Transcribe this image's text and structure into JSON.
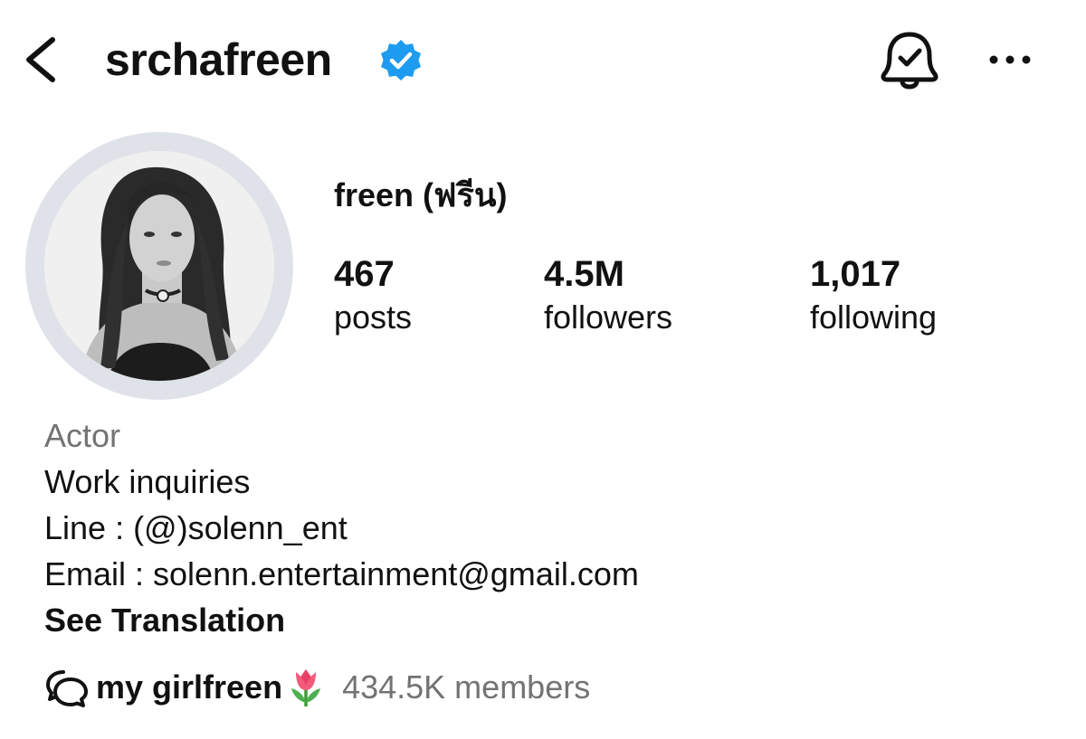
{
  "header": {
    "username": "srchafreen",
    "back_icon": "chevron-left-icon",
    "verified_icon": "verified-badge-icon",
    "bell_icon": "bell-check-icon",
    "more_icon": "more-horizontal-icon",
    "verified_color": "#1d9bf0"
  },
  "profile": {
    "display_name": "freen (ฟรีน)",
    "stats": {
      "posts": {
        "count": "467",
        "label": "posts"
      },
      "followers": {
        "count": "4.5M",
        "label": "followers"
      },
      "following": {
        "count": "1,017",
        "label": "following"
      }
    }
  },
  "bio": {
    "category": "Actor",
    "lines": [
      "Work inquiries",
      "Line : (@)solenn_ent",
      "Email : solenn.entertainment@gmail.com"
    ],
    "translate_label": "See Translation"
  },
  "channel": {
    "icon": "chat-bubbles-icon",
    "name": "my girlfreen",
    "emoji": "tulip",
    "members": "434.5K members"
  }
}
